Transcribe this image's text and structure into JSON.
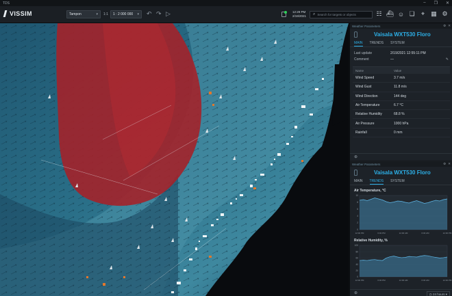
{
  "window": {
    "title": "TDS"
  },
  "toolbar": {
    "brand": "VISSIM",
    "layer_select": "Tampon",
    "scale_ratio": "1:1",
    "zoom_select": "1 : 2 000 000",
    "clock_time": "12:29 PM",
    "clock_date": "2/19/2021",
    "search_placeholder": "Search for targets or objects"
  },
  "panel_top": {
    "header": "Weather Parameters",
    "device_name": "Vaisala WXT530 Floro",
    "tabs": [
      "MAIN",
      "TRENDS",
      "SYSTEM"
    ],
    "active_tab": "MAIN",
    "last_update_label": "Last update",
    "last_update_value": "2/19/2021 12:55:11 PM",
    "comment_label": "Comment",
    "comment_value": "—",
    "table_headers": {
      "name": "Name",
      "value": "Value"
    },
    "rows": [
      {
        "name": "Wind Speed",
        "value": "3.7 m/s"
      },
      {
        "name": "Wind Gust",
        "value": "11.8 m/s"
      },
      {
        "name": "Wind Direction",
        "value": "144 deg"
      },
      {
        "name": "Air Temperature",
        "value": "6.7 °C"
      },
      {
        "name": "Relative Humidity",
        "value": "68.8 %"
      },
      {
        "name": "Air Pressure",
        "value": "1000 hPa"
      },
      {
        "name": "Rainfall",
        "value": "0 mm"
      }
    ]
  },
  "panel_bottom": {
    "header": "Weather Parameters",
    "device_name": "Vaisala WXT530 Floro",
    "tabs": [
      "MAIN",
      "TRENDS",
      "SYSTEM"
    ],
    "active_tab": "TRENDS",
    "interval_select": "24 hours",
    "chart_data": [
      {
        "type": "area",
        "title": "Air Temperature, °C",
        "x": [
          "12:00 PM",
          "6:00 PM",
          "12:00 AM",
          "6:00 AM",
          "12:00 PM"
        ],
        "ylim": [
          0,
          10
        ],
        "series": [
          {
            "values": [
              8.6,
              8.8,
              8.5,
              8.9,
              9.3,
              9.0,
              8.7,
              8.2,
              7.9,
              8.1,
              8.4,
              8.3,
              8.0,
              7.8,
              8.2,
              8.5,
              8.1,
              7.7,
              7.9,
              8.3,
              8.6,
              8.4,
              8.8,
              9.0
            ]
          }
        ]
      },
      {
        "type": "area",
        "title": "Relative Humidity, %",
        "x": [
          "12:00 PM",
          "6:00 PM",
          "12:00 AM",
          "6:00 AM",
          "12:00 PM"
        ],
        "ylim": [
          0,
          100
        ],
        "series": [
          {
            "values": [
              52,
              53,
              52,
              54,
              55,
              53,
              52,
              60,
              64,
              66,
              63,
              61,
              62,
              65,
              64,
              63,
              66,
              68,
              67,
              64,
              62,
              60,
              61,
              63
            ]
          }
        ]
      }
    ]
  },
  "colors": {
    "accent": "#2db0e8",
    "danger_zone": "#a3222a",
    "sea_light": "#4f8fa4",
    "sea_dark": "#173f55"
  }
}
